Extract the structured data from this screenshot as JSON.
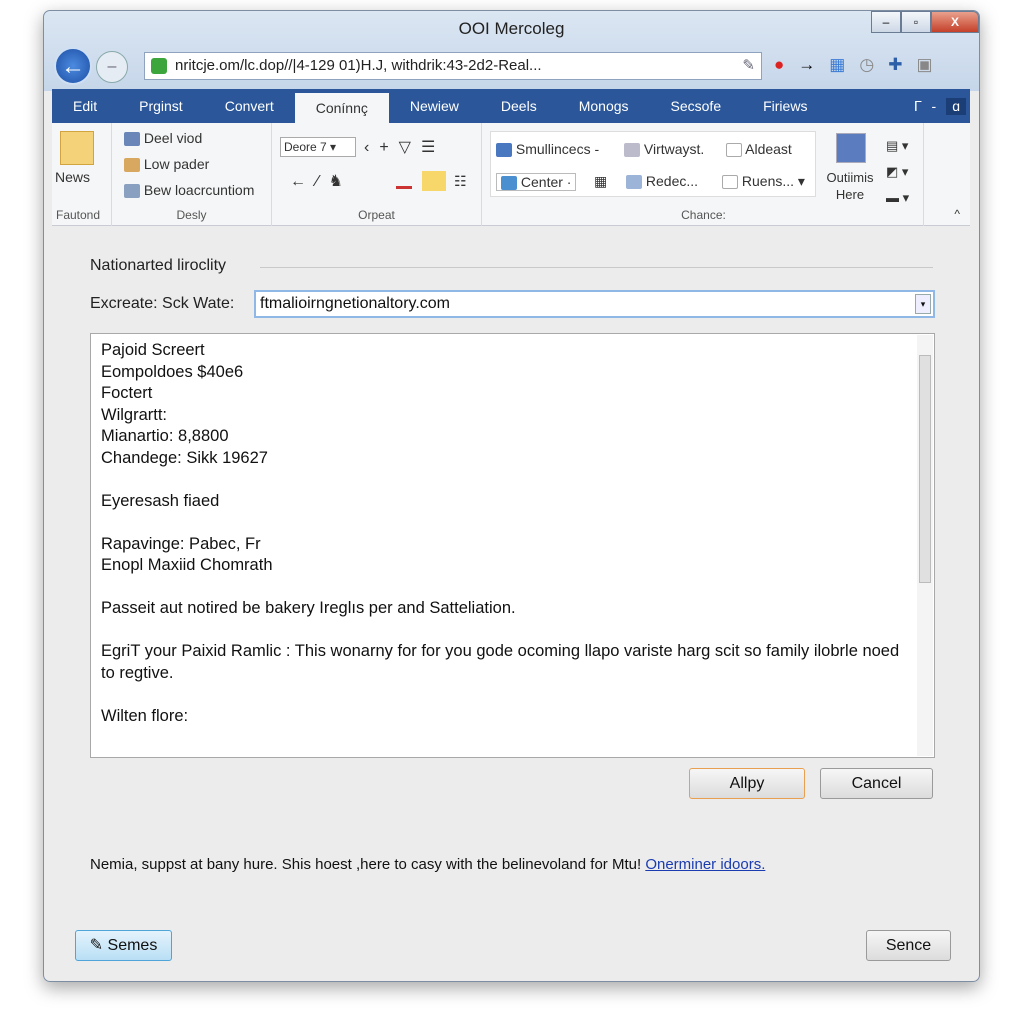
{
  "window": {
    "title": "OOI Mercoleg",
    "address": "nritcje.om/lc.dop//|4-129 01)H.J, withdrik:43-2d2-Real..."
  },
  "tabs": [
    {
      "label": "Edit"
    },
    {
      "label": "Prginst"
    },
    {
      "label": "Convert"
    },
    {
      "label": "Conínnç",
      "active": true
    },
    {
      "label": "Newiew"
    },
    {
      "label": "Deels"
    },
    {
      "label": "Monogs"
    },
    {
      "label": "Secsofe"
    },
    {
      "label": "Firiews"
    }
  ],
  "ribbon": {
    "news": "News",
    "group1": "Fautond",
    "desly_items": [
      "Deel viod",
      "Low pader",
      "Bew loacrcuntiom"
    ],
    "group2": "Desly",
    "font_select": "Deore  7",
    "group3": "Orpeat",
    "chance_items": [
      "Smullincecs -",
      "Virtwayst.",
      "Aldeast",
      "Center",
      "Redec...",
      "Ruens..."
    ],
    "big_button": "Outiimis Here",
    "group4": "Chance:"
  },
  "dialog": {
    "section": "Nationarted liroclity",
    "field_label": "Excreate: Sck Wate:",
    "field_value": "ftmalioirngnetionaltory.com",
    "body_lines": [
      "Pajoid Screert",
      "Eompoldoes $40e6",
      "Foctert",
      "Wilgrartt:",
      "Mianartio: 8,8800",
      "Chandege: Sikk 19627",
      "",
      "Eyeresash fiaed",
      "",
      "Rapavinge: Pabec, Fr",
      "Enopl Maxiid Chomrath",
      "",
      "Passeit aut notired be bakery Ireglıs per and Satteliation.",
      "",
      "EgriT your Paixid Ramlic : This wonarny for for you gode ocoming llapo variste harg scit so family ilobrle noed to regtive.",
      "",
      "Wilten flore:"
    ],
    "apply": "Allpy",
    "cancel": "Cancel",
    "note": "Nemia, suppst at bany hure. Shis hoest ,here to casy with the belinevoland for Mtu!",
    "link": "Onerminer idoors.",
    "semes": "Semes",
    "sence": "Sence"
  },
  "colors": {
    "tabbar": "#2b579a",
    "link": "#1a3cb0",
    "apply_border": "#e8a050"
  }
}
